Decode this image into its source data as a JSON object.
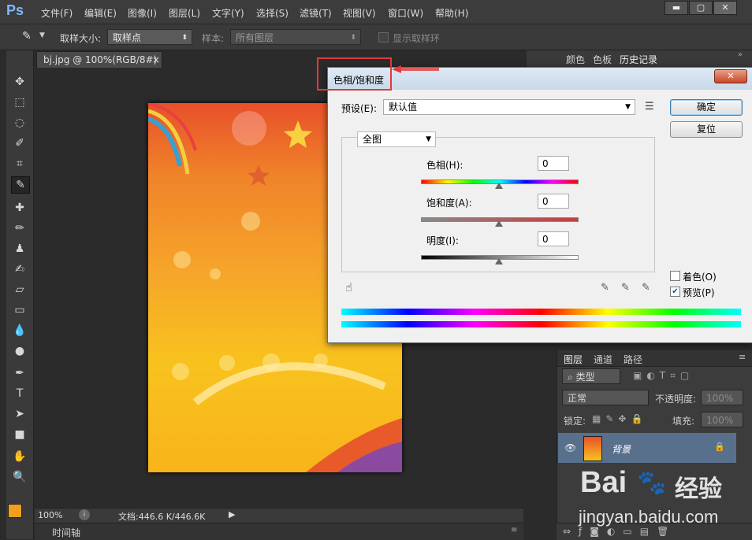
{
  "app": {
    "logo": "Ps"
  },
  "menu": [
    "文件(F)",
    "编辑(E)",
    "图像(I)",
    "图层(L)",
    "文字(Y)",
    "选择(S)",
    "滤镜(T)",
    "视图(V)",
    "窗口(W)",
    "帮助(H)"
  ],
  "window_controls": {
    "minimize": "▬",
    "maximize": "▢",
    "close": "✕"
  },
  "options_bar": {
    "sample_size_label": "取样大小:",
    "sample_size_value": "取样点",
    "sample_label": "样本:",
    "sample_value": "所有图层",
    "show_ring_label": "显示取样环"
  },
  "document": {
    "tab_title": "bj.jpg @ 100%(RGB/8#)",
    "tab_close": "×",
    "zoom": "100%",
    "doc_info": "文档:446.6 K/446.6K",
    "timeline_label": "时间轴"
  },
  "dialog": {
    "title": "色相/饱和度",
    "close": "✕",
    "preset_label": "预设(E):",
    "preset_value": "默认值",
    "ok": "确定",
    "reset": "复位",
    "channel": "全图",
    "hue_label": "色相(H):",
    "hue_value": "0",
    "saturation_label": "饱和度(A):",
    "saturation_value": "0",
    "lightness_label": "明度(I):",
    "lightness_value": "0",
    "colorize_label": "着色(O)",
    "colorize_checked": false,
    "preview_label": "预览(P)",
    "preview_checked": true
  },
  "layers_panel": {
    "tabs": [
      "图层",
      "通道",
      "路径"
    ],
    "active_tab": "图层",
    "filter_type": "类型",
    "blend_mode": "正常",
    "opacity_label": "不透明度:",
    "opacity_value": "100%",
    "lock_label": "锁定:",
    "fill_label": "填充:",
    "fill_value": "100%",
    "layer_name": "背景"
  },
  "right_top_tabs": [
    "颜色",
    "色板",
    "历史记录"
  ],
  "watermark": {
    "brand": "Bai",
    "brand2": "经验",
    "url": "jingyan.baidu.com"
  },
  "colors": {
    "highlight_box": "#e03a3a",
    "foreground_swatch": "#f0a020",
    "background_swatch": "#ffffff",
    "dialog_title_bg": "#c9d8ea",
    "layer_selected": "#58708c"
  },
  "icons": {
    "eyedropper": "eyedropper-icon",
    "move": "move-icon",
    "marquee": "marquee-icon",
    "lasso": "lasso-icon",
    "crop": "crop-icon",
    "brush": "brush-icon",
    "hand": "hand-icon",
    "zoom": "zoom-icon"
  }
}
